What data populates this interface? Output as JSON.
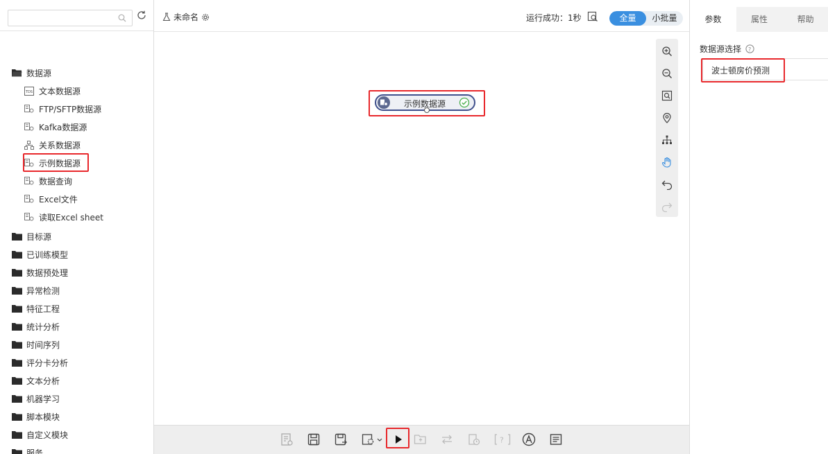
{
  "sidebar": {
    "search_placeholder": "",
    "categories": [
      {
        "label": "数据源",
        "expanded": true,
        "items": [
          {
            "label": "文本数据源",
            "icon": "text-file-icon"
          },
          {
            "label": "FTP/SFTP数据源",
            "icon": "datasource-icon"
          },
          {
            "label": "Kafka数据源",
            "icon": "datasource-icon"
          },
          {
            "label": "关系数据源",
            "icon": "relational-icon"
          },
          {
            "label": "示例数据源",
            "icon": "datasource-icon",
            "highlighted": true
          },
          {
            "label": "数据查询",
            "icon": "datasource-icon"
          },
          {
            "label": "Excel文件",
            "icon": "datasource-icon"
          },
          {
            "label": "读取Excel sheet",
            "icon": "datasource-icon"
          }
        ]
      },
      {
        "label": "目标源"
      },
      {
        "label": "已训练模型"
      },
      {
        "label": "数据预处理"
      },
      {
        "label": "异常检测"
      },
      {
        "label": "特征工程"
      },
      {
        "label": "统计分析"
      },
      {
        "label": "时间序列"
      },
      {
        "label": "评分卡分析"
      },
      {
        "label": "文本分析"
      },
      {
        "label": "机器学习"
      },
      {
        "label": "脚本模块"
      },
      {
        "label": "自定义模块"
      },
      {
        "label": "服务"
      }
    ]
  },
  "header": {
    "doc_title": "未命名",
    "status_text": "运行成功：1秒",
    "mode_full": "全量",
    "mode_batch": "小批量",
    "active_mode": "全量"
  },
  "canvas": {
    "node": {
      "label": "示例数据源",
      "status": "success"
    }
  },
  "right_panel": {
    "tabs": [
      "参数",
      "属性",
      "帮助"
    ],
    "active_tab": "参数",
    "field_label": "数据源选择",
    "field_value": "波士顿房价预测"
  },
  "colors": {
    "accent": "#3a8fe0",
    "highlight": "#e8272b",
    "node_border": "#3f4f8c",
    "success": "#4caf50"
  }
}
